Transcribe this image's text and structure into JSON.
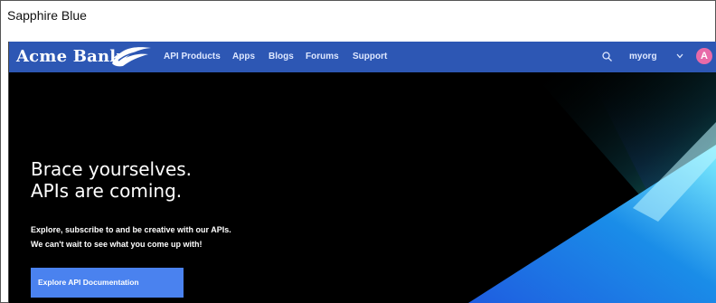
{
  "caption": "Sapphire Blue",
  "header": {
    "brand": "Acme Bank",
    "nav": [
      "API Products",
      "Apps",
      "Blogs",
      "Forums",
      "Support"
    ],
    "org": "myorg",
    "avatar_initial": "A"
  },
  "hero": {
    "headline_line1": "Brace yourselves.",
    "headline_line2": "APIs are coming.",
    "subtext_line1": "Explore, subscribe to and be creative with our APIs.",
    "subtext_line2": "We can't wait to see what you come up with!",
    "cta_label": "Explore API Documentation"
  },
  "colors": {
    "nav_bg": "#2d57b4",
    "cta_bg": "#4a82ef",
    "avatar_bg": "#e86aa8"
  },
  "icons": [
    "logo-wing-icon",
    "search-icon",
    "chevron-down-icon"
  ]
}
